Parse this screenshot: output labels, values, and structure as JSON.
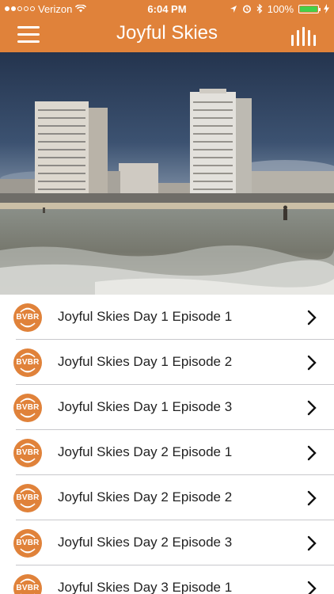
{
  "status_bar": {
    "carrier": "Verizon",
    "time": "6:04 PM",
    "battery": "100%"
  },
  "nav": {
    "title": "Joyful Skies",
    "menu_icon": "hamburger-icon",
    "right_icon": "bars-icon"
  },
  "hero": {
    "image": "beach-with-hotel-towers"
  },
  "logo_text": "BVBR",
  "episodes": [
    {
      "title": "Joyful Skies Day 1 Episode 1"
    },
    {
      "title": "Joyful Skies Day 1 Episode 2"
    },
    {
      "title": "Joyful Skies Day 1 Episode 3"
    },
    {
      "title": "Joyful Skies Day 2 Episode 1"
    },
    {
      "title": "Joyful Skies Day 2 Episode 2"
    },
    {
      "title": "Joyful Skies Day 2 Episode 3"
    },
    {
      "title": "Joyful Skies Day 3 Episode 1"
    }
  ],
  "colors": {
    "accent": "#e0823a",
    "battery": "#44d04a",
    "separator": "#c8c8cc"
  }
}
